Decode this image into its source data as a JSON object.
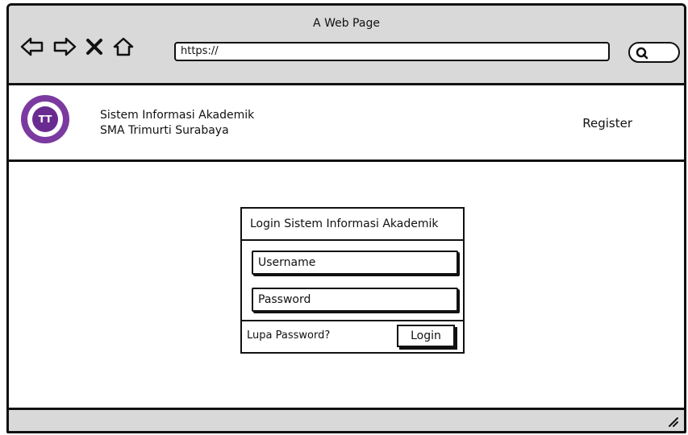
{
  "browser": {
    "title": "A Web Page",
    "url": "https://"
  },
  "header": {
    "brand_line1": "Sistem Informasi Akademik",
    "brand_line2": "SMA Trimurti Surabaya",
    "register_label": "Register",
    "logo_text": "TT"
  },
  "login": {
    "title": "Login Sistem Informasi Akademik",
    "username_value": "Username",
    "password_value": "Password",
    "forgot_label": "Lupa Password?",
    "login_label": "Login"
  },
  "colors": {
    "chrome": "#d9d9d9",
    "logo_purple": "#7b3aa0",
    "ink": "#111111"
  }
}
